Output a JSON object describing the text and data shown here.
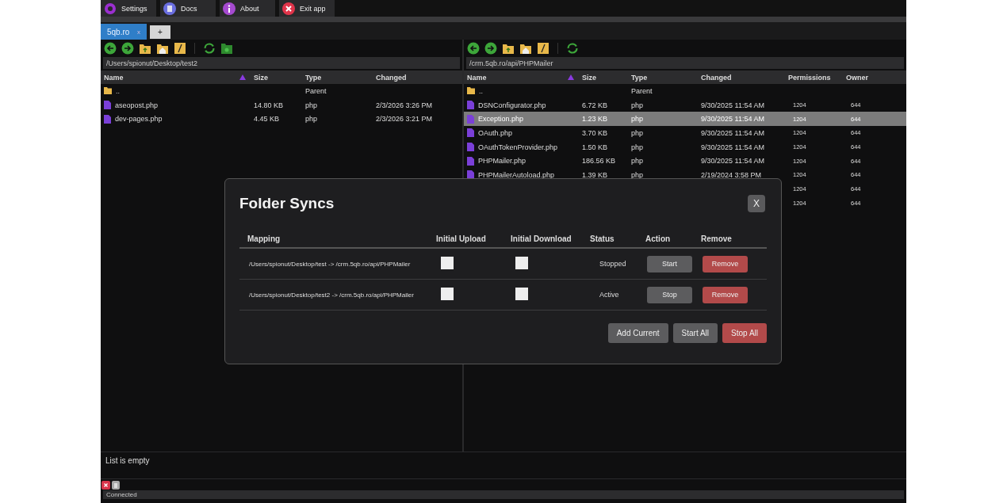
{
  "menu": [
    {
      "label": "Settings",
      "kind": "settings"
    },
    {
      "label": "Docs",
      "kind": "docs"
    },
    {
      "label": "About",
      "kind": "about"
    },
    {
      "label": "Exit app",
      "kind": "exit"
    }
  ],
  "tabs": [
    {
      "label": "5qb.ro",
      "close": "x",
      "selected": true
    },
    {
      "label": "+",
      "selected": false
    }
  ],
  "panes": [
    {
      "path": "/Users/spionut/Desktop/test2",
      "columns": [
        "Name",
        "Size",
        "Type",
        "Changed"
      ],
      "rows": [
        {
          "kind": "folder",
          "cells": [
            "..",
            "",
            "Parent",
            ""
          ],
          "selected": false
        },
        {
          "kind": "file",
          "cells": [
            "aseopost.php",
            "14.80 KB",
            "php",
            "2/3/2026 3:26 PM"
          ],
          "selected": false
        },
        {
          "kind": "file",
          "cells": [
            "dev-pages.php",
            "4.45 KB",
            "php",
            "2/3/2026 3:21 PM"
          ],
          "selected": false
        }
      ]
    },
    {
      "path": "/crm.5qb.ro/api/PHPMailer",
      "columns": [
        "Name",
        "Size",
        "Type",
        "Changed",
        "Permissions",
        "Owner"
      ],
      "rows": [
        {
          "kind": "folder",
          "cells": [
            "..",
            "",
            "Parent",
            "",
            "",
            ""
          ],
          "selected": false
        },
        {
          "kind": "file",
          "cells": [
            "DSNConfigurator.php",
            "6.72 KB",
            "php",
            "9/30/2025 11:54 AM",
            "1204",
            "644"
          ],
          "selected": false
        },
        {
          "kind": "file",
          "cells": [
            "Exception.php",
            "1.23 KB",
            "php",
            "9/30/2025 11:54 AM",
            "1204",
            "644"
          ],
          "selected": true
        },
        {
          "kind": "file",
          "cells": [
            "OAuth.php",
            "3.70 KB",
            "php",
            "9/30/2025 11:54 AM",
            "1204",
            "644"
          ],
          "selected": false
        },
        {
          "kind": "file",
          "cells": [
            "OAuthTokenProvider.php",
            "1.50 KB",
            "php",
            "9/30/2025 11:54 AM",
            "1204",
            "644"
          ],
          "selected": false
        },
        {
          "kind": "file",
          "cells": [
            "PHPMailer.php",
            "186.56 KB",
            "php",
            "9/30/2025 11:54 AM",
            "1204",
            "644"
          ],
          "selected": false
        },
        {
          "kind": "file",
          "cells": [
            "PHPMailerAutoload.php",
            "1.39 KB",
            "php",
            "2/19/2024 3:58 PM",
            "1204",
            "644"
          ],
          "selected": false
        },
        {
          "kind": "covered",
          "cells": [
            "1204",
            "644"
          ],
          "selected": false
        },
        {
          "kind": "covered",
          "cells": [
            "1204",
            "644"
          ],
          "selected": false
        }
      ]
    }
  ],
  "log": "List is empty",
  "status": "Connected",
  "dialog": {
    "title": "Folder Syncs",
    "close": "X",
    "columns": [
      "Mapping",
      "Initial Upload",
      "Initial Download",
      "Status",
      "Action",
      "Remove"
    ],
    "rows": [
      {
        "mapping": "/Users/spionut/Desktop/test -> /crm.5qb.ro/api/PHPMailer",
        "initial_upload": false,
        "initial_download": false,
        "status": "Stopped",
        "action": "Start",
        "remove": "Remove"
      },
      {
        "mapping": "/Users/spionut/Desktop/test2 -> /crm.5qb.ro/api/PHPMailer",
        "initial_upload": false,
        "initial_download": false,
        "status": "Active",
        "action": "Stop",
        "remove": "Remove"
      }
    ],
    "buttons": [
      {
        "label": "Add Current",
        "kind": "neutral"
      },
      {
        "label": "Start All",
        "kind": "neutral"
      },
      {
        "label": "Stop All",
        "kind": "danger"
      }
    ]
  }
}
